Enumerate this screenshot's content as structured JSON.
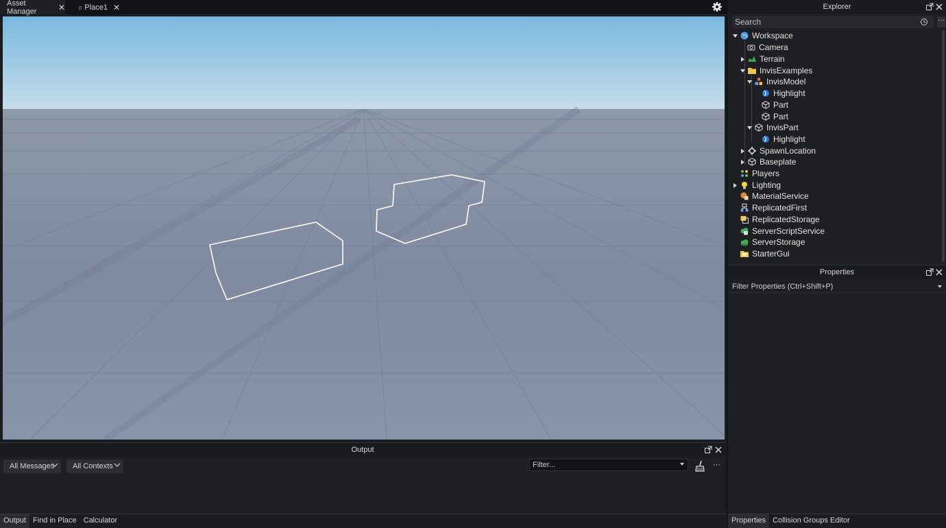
{
  "tabs": [
    {
      "label": "Asset Manager",
      "close": "✕"
    },
    {
      "label": "Place1",
      "close": "✕"
    }
  ],
  "output": {
    "title": "Output",
    "messages_filter": "All Messages",
    "contexts_filter": "All Contexts",
    "filter_placeholder": "Filter...",
    "more": "···"
  },
  "bottom_tabs": [
    "Output",
    "Find in Place",
    "Calculator"
  ],
  "explorer": {
    "title": "Explorer",
    "search_placeholder": "Search",
    "more": "···",
    "items": [
      {
        "label": "Workspace",
        "icon": "workspace-globe-icon"
      },
      {
        "label": "Camera",
        "icon": "camera-icon"
      },
      {
        "label": "Terrain",
        "icon": "terrain-icon"
      },
      {
        "label": "InvisExamples",
        "icon": "folder-icon"
      },
      {
        "label": "InvisModel",
        "icon": "model-icon"
      },
      {
        "label": "Highlight",
        "icon": "highlight-icon"
      },
      {
        "label": "Part",
        "icon": "part-cube-icon"
      },
      {
        "label": "Part",
        "icon": "part-cube-icon"
      },
      {
        "label": "InvisPart",
        "icon": "part-cube-icon"
      },
      {
        "label": "Highlight",
        "icon": "highlight-icon"
      },
      {
        "label": "SpawnLocation",
        "icon": "spawn-gear-icon"
      },
      {
        "label": "Baseplate",
        "icon": "part-cube-icon"
      },
      {
        "label": "Players",
        "icon": "players-icon"
      },
      {
        "label": "Lighting",
        "icon": "lightbulb-icon"
      },
      {
        "label": "MaterialService",
        "icon": "material-service-icon"
      },
      {
        "label": "ReplicatedFirst",
        "icon": "replicated-first-icon"
      },
      {
        "label": "ReplicatedStorage",
        "icon": "replicated-storage-icon"
      },
      {
        "label": "ServerScriptService",
        "icon": "server-script-service-icon"
      },
      {
        "label": "ServerStorage",
        "icon": "server-storage-icon"
      },
      {
        "label": "StarterGui",
        "icon": "starter-gui-icon"
      }
    ]
  },
  "properties": {
    "title": "Properties",
    "filter_placeholder": "Filter Properties (Ctrl+Shift+P)"
  },
  "right_bottom_tabs": [
    "Properties",
    "Collision Groups Editor"
  ],
  "colors": {
    "accent_selection": "#ffffff",
    "sky_top": "#7fbde0",
    "baseplate": "#8c98ad"
  }
}
